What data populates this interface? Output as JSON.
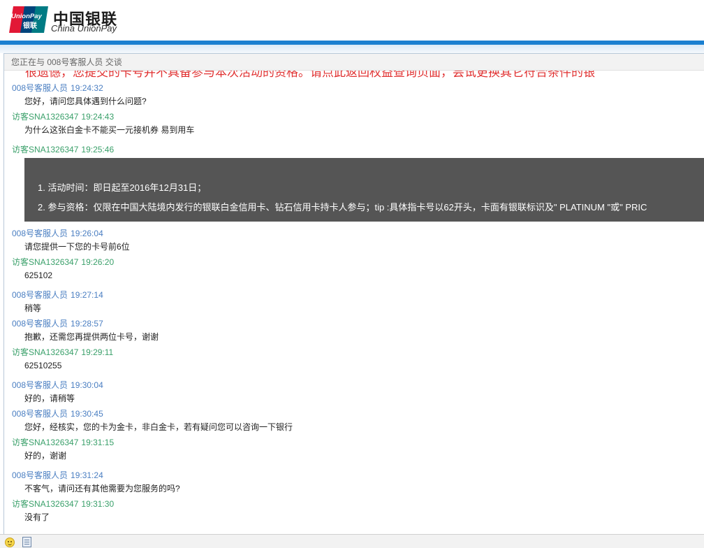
{
  "header": {
    "logo_mark_top": "UnionPay",
    "logo_mark_bottom": "银联",
    "logo_cn": "中国银联",
    "logo_en": "China UnionPay"
  },
  "chat": {
    "title": "您正在与 008号客服人员 交谈",
    "cut_message": "很遗憾，您提交的卡号并不具备参与本次活动的资格。请点此返回权益查询页面，尝试更换其它符合条件的银",
    "messages": [
      {
        "sender": "008号客服人员",
        "time": "19:24:32",
        "role": "agent",
        "text": "您好，请问您具体遇到什么问题?"
      },
      {
        "sender": "访客SNA1326347",
        "time": "19:24:43",
        "role": "visitor",
        "text": "为什么这张白金卡不能买一元接机券 易到用车"
      },
      {
        "sender": "访客SNA1326347",
        "time": "19:25:46",
        "role": "visitor",
        "text": ""
      },
      {
        "sender": "008号客服人员",
        "time": "19:26:04",
        "role": "agent",
        "text": "请您提供一下您的卡号前6位"
      },
      {
        "sender": "访客SNA1326347",
        "time": "19:26:20",
        "role": "visitor",
        "text": "625102"
      },
      {
        "sender": "008号客服人员",
        "time": "19:27:14",
        "role": "agent",
        "text": "稍等"
      },
      {
        "sender": "008号客服人员",
        "time": "19:28:57",
        "role": "agent",
        "text": "抱歉，还需您再提供两位卡号，谢谢"
      },
      {
        "sender": "访客SNA1326347",
        "time": "19:29:11",
        "role": "visitor",
        "text": "62510255"
      },
      {
        "sender": "008号客服人员",
        "time": "19:30:04",
        "role": "agent",
        "text": "好的，请稍等"
      },
      {
        "sender": "008号客服人员",
        "time": "19:30:45",
        "role": "agent",
        "text": "您好，经核实，您的卡为金卡，非白金卡，若有疑问您可以咨询一下银行"
      },
      {
        "sender": "访客SNA1326347",
        "time": "19:31:15",
        "role": "visitor",
        "text": "好的，谢谢"
      },
      {
        "sender": "008号客服人员",
        "time": "19:31:24",
        "role": "agent",
        "text": "不客气，请问还有其他需要为您服务的吗?"
      },
      {
        "sender": "访客SNA1326347",
        "time": "19:31:30",
        "role": "visitor",
        "text": "没有了"
      }
    ],
    "notice": {
      "line1": "1. 活动时间：即日起至2016年12月31日；",
      "line2": "2. 参与资格：仅限在中国大陆境内发行的银联白金信用卡、钻石信用卡持卡人参与；tip :具体指卡号以62开头，卡面有银联标识及\" PLATINUM \"或\" PRIC"
    }
  },
  "toolbar": {
    "emoji_icon": "smiley-icon",
    "history_icon": "document-icon"
  },
  "colors": {
    "agent": "#4b7fc2",
    "visitor": "#3aa06a",
    "header_bar": "#1a7fd0",
    "notice_bg": "#555555"
  }
}
